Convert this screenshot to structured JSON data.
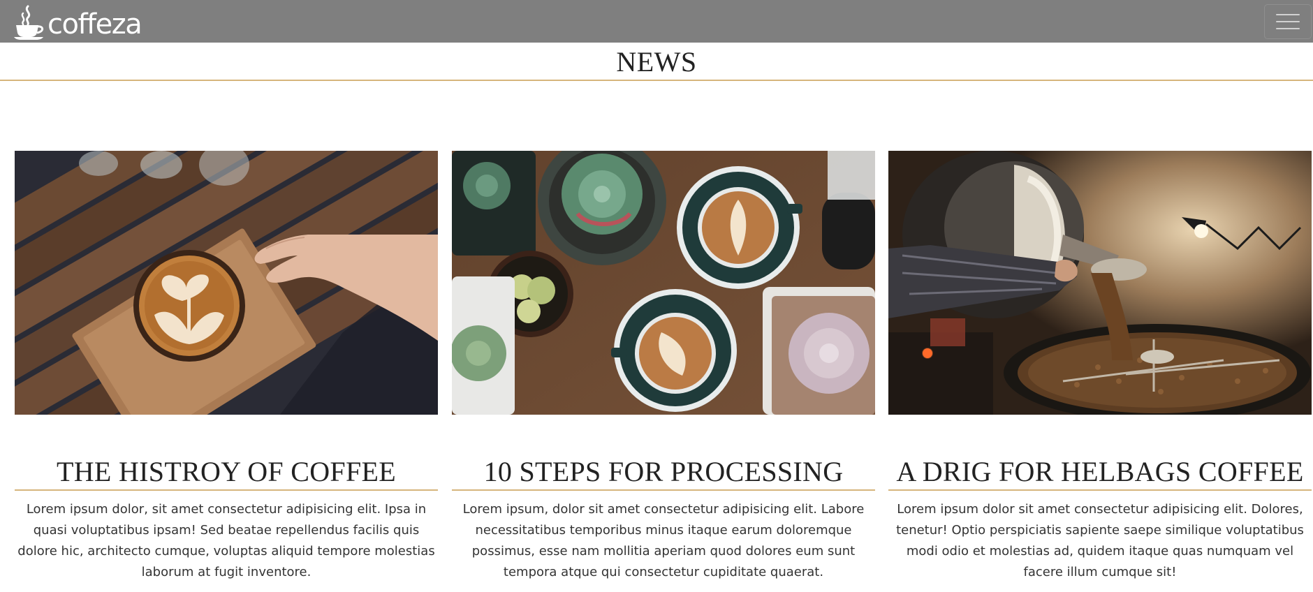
{
  "navbar": {
    "brand_name": "coffeza",
    "logo_icon": "coffee-cup-icon",
    "menu_icon": "hamburger-menu-icon",
    "background": "#7f7f7f"
  },
  "section": {
    "title": "NEWS",
    "accent_color": "#d6b57c"
  },
  "cards": [
    {
      "image_icon": "latte-art-on-wooden-tray-image",
      "title": "THE HISTROY OF COFFEE",
      "text": "Lorem ipsum dolor, sit amet consectetur adipisicing elit. Ipsa in quasi voluptatibus ipsam! Sed beatae repellendus facilis quis dolore hic, architecto cumque, voluptas aliquid tempore molestias laborum at fugit inventore."
    },
    {
      "image_icon": "coffee-cups-and-succulents-image",
      "title": "10 STEPS FOR PROCESSING",
      "text": "Lorem ipsum, dolor sit amet consectetur adipisicing elit. Labore necessitatibus temporibus minus itaque earum doloremque possimus, esse nam mollitia aperiam quod dolores eum sunt tempora atque qui consectetur cupiditate quaerat."
    },
    {
      "image_icon": "coffee-roaster-machine-image",
      "title": "A DRIG FOR HELBAGS COFFEE",
      "text": "Lorem ipsum dolor sit amet consectetur adipisicing elit. Dolores, tenetur! Optio perspiciatis sapiente saepe similique voluptatibus modi odio et molestias ad, quidem itaque quas numquam vel facere illum cumque sit!"
    }
  ]
}
